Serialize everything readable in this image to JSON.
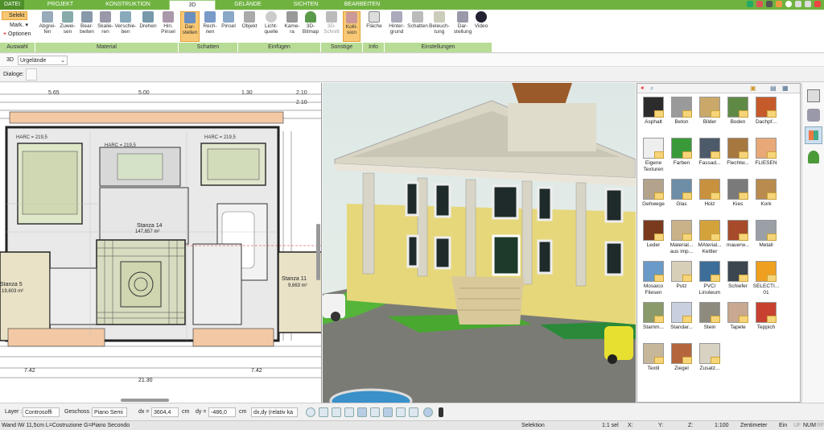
{
  "tabs": [
    "DATEI",
    "PROJEKT",
    "KONSTRUKTION",
    "3D",
    "GELÄNDE",
    "SICHTEN",
    "BEARBEITEN"
  ],
  "ribbon": {
    "select": {
      "selekt": "Selekt",
      "mark": "Mark.",
      "optionen": "Optionen"
    },
    "buttons": [
      "Abgrei-\nfen",
      "Zuwei-\nsen",
      "Bear-\nbeiten",
      "Skalie-\nren",
      "Verschie-\nben",
      "Drehen",
      "Hin.\nPinsel",
      "Dar-\nstellen",
      "Rech-\nnen",
      "Pinsel",
      "Objekt",
      "Licht-\nquelle",
      "Kame-\nra",
      "3D-\nBitmap",
      "3D-\nSchnitt",
      "Kolli-\nsion",
      "Fläche",
      "Hinter-\ngrund",
      "Schatten",
      "Beleuch-\ntung",
      "Dar-\nstellung",
      "Video"
    ],
    "groups": [
      "Auswahl",
      "Material",
      "Schatten",
      "Einfügen",
      "Sonstige",
      "Info",
      "Einstellungen"
    ]
  },
  "toolbar": {
    "view_label": "3D",
    "view_value": "Urgelände",
    "dialoge": "Dialoge:"
  },
  "plan": {
    "dims_top": [
      "5.65",
      "5.00",
      "1.30",
      "2.10",
      "2.10"
    ],
    "rooms": [
      {
        "name": "Stanza 14",
        "area": "147,857 m²"
      },
      {
        "name": "Stanza 5",
        "area": "19,603 m²"
      },
      {
        "name": "Stanza 11",
        "area": "9,663 m²"
      }
    ],
    "harc_label": "HARC = 219,5",
    "dims_bottom": [
      "7.42",
      "7.42",
      "21.30"
    ]
  },
  "catalog": {
    "items": [
      {
        "label": "Asphalt",
        "color": "#2c2c2c"
      },
      {
        "label": "Beton",
        "color": "#9a9a9a"
      },
      {
        "label": "Bilder",
        "color": "#c9a86a"
      },
      {
        "label": "Boden",
        "color": "#5f8a46"
      },
      {
        "label": "Dachpf...",
        "color": "#c55a2a"
      },
      {
        "label": "Eigene\nTexturen",
        "color": "#eeeeee"
      },
      {
        "label": "Farben",
        "color": "#3a9a3a"
      },
      {
        "label": "Fassad...",
        "color": "#4c5a6a"
      },
      {
        "label": "Flechtw...",
        "color": "#a77740"
      },
      {
        "label": "FLIESEN",
        "color": "#e8a878"
      },
      {
        "label": "Gehwege",
        "color": "#b3a38c"
      },
      {
        "label": "Glas",
        "color": "#6e8ea8"
      },
      {
        "label": "Holz",
        "color": "#c8913e"
      },
      {
        "label": "Kies",
        "color": "#7a7a7a"
      },
      {
        "label": "Kork",
        "color": "#b98b4e"
      },
      {
        "label": "Leder",
        "color": "#7a3a1e"
      },
      {
        "label": "Material...\naus imp...",
        "color": "#c9b28a"
      },
      {
        "label": "MAterial...\nKettler",
        "color": "#d4a23a"
      },
      {
        "label": "mauerw...",
        "color": "#a64a2a"
      },
      {
        "label": "Metall",
        "color": "#9aa0a6"
      },
      {
        "label": "Mosaico\nFliesen",
        "color": "#6a9ac8"
      },
      {
        "label": "Putz",
        "color": "#d8cfb8"
      },
      {
        "label": "PVC/\nLinoleum",
        "color": "#3d6e9a"
      },
      {
        "label": "Schiefer",
        "color": "#3c4650"
      },
      {
        "label": "SELECTI...\n01",
        "color": "#f0a020"
      },
      {
        "label": "Stamm...",
        "color": "#8a9a6a"
      },
      {
        "label": "Standar...",
        "color": "#c8d0e0"
      },
      {
        "label": "Stein",
        "color": "#8e8a7e"
      },
      {
        "label": "Tapete",
        "color": "#c8a890"
      },
      {
        "label": "Teppich",
        "color": "#c84030"
      },
      {
        "label": "Textil",
        "color": "#c7b79a"
      },
      {
        "label": "Ziegel",
        "color": "#b5653b"
      },
      {
        "label": "Zusatz...",
        "color": "#d8d2c2"
      }
    ]
  },
  "bottom": {
    "layer_label": "Layer :",
    "layer_value": "Controsoffi",
    "geschoss_label": "Geschoss :",
    "geschoss_value": "Piano Semi",
    "dx_label": "dx =",
    "dx_value": "3604,4",
    "dy_label": "dy =",
    "dy_value": "-486,0",
    "unit": "cm",
    "mode_value": "dx,dy (relativ ka"
  },
  "status": {
    "left": "Wand IW 11,5cm L=Costruzione G=Piano Secondo",
    "mode": "Selektion",
    "scale": "1:1 sel",
    "x": "X:",
    "y": "Y:",
    "z": "Z:",
    "ratio": "1:100",
    "unit": "Zentimeter",
    "ein": "Ein",
    "uf": "UF",
    "num": "NUM",
    "rf": "RF"
  }
}
